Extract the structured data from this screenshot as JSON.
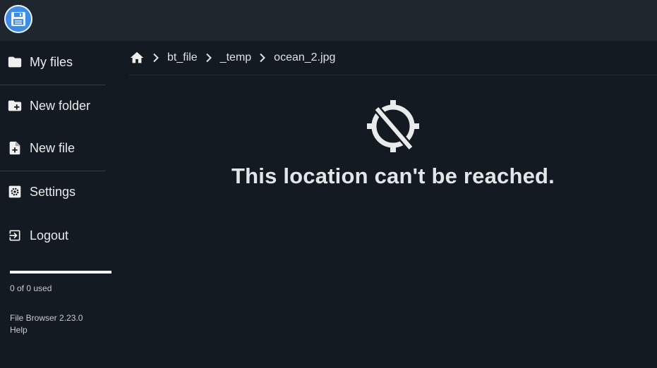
{
  "app": {
    "logo_icon": "floppy-disk-icon",
    "accent_color": "#3f8be8"
  },
  "sidebar": {
    "items": [
      {
        "label": "My files",
        "icon": "folder-icon"
      },
      {
        "label": "New folder",
        "icon": "create-new-folder-icon"
      },
      {
        "label": "New file",
        "icon": "note-add-icon"
      },
      {
        "label": "Settings",
        "icon": "settings-icon"
      },
      {
        "label": "Logout",
        "icon": "logout-icon"
      }
    ],
    "usage": {
      "text": "0 of 0 used",
      "fraction": 0
    },
    "version": "File Browser 2.23.0",
    "help": "Help"
  },
  "breadcrumb": {
    "home_icon": "home-icon",
    "items": [
      "bt_file",
      "_temp",
      "ocean_2.jpg"
    ]
  },
  "main": {
    "error_icon": "gps-off-icon",
    "error_message": "This location can't be reached."
  }
}
